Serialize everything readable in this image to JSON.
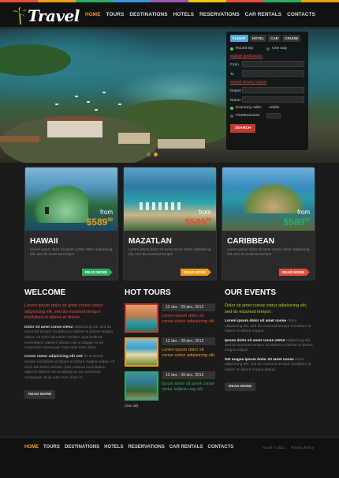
{
  "brand": {
    "name": "Travel",
    "colors": [
      "#e74c3c",
      "#f39c12",
      "#27ae60",
      "#3498db",
      "#9b59b6",
      "#f1c40f"
    ]
  },
  "nav": {
    "items": [
      {
        "label": "HOME",
        "active": true
      },
      {
        "label": "TOURS"
      },
      {
        "label": "DESTINATIONS"
      },
      {
        "label": "HOTELS"
      },
      {
        "label": "RESERVATIONS"
      },
      {
        "label": "CAR RENTALS"
      },
      {
        "label": "CONTACTS"
      }
    ]
  },
  "booking": {
    "tabs": [
      "FLIGHT",
      "HOTEL",
      "CAR",
      "CRUISE"
    ],
    "trip_round": "Round trip",
    "trip_one": "One way",
    "multi": "Multiple destinations",
    "from_label": "From",
    "to_label": "To",
    "search_nearby": "Search Nearby Airports",
    "depart_label": "Depart",
    "return_label": "Return",
    "class_economy": "Economy cabin",
    "adults_label": "Adults",
    "class_first": "First/Business",
    "search_button": "SEARCH"
  },
  "cards": [
    {
      "name": "HAWAII",
      "from": "from",
      "price": "$589",
      "cents": "99",
      "price_color": "#f39c12",
      "text": "Lorem ipsum dolor sit amet conse ctetur adipisicing elit, sed do eiusmod tempor",
      "button": "READ MORE",
      "button_color": "#27ae60"
    },
    {
      "name": "MAZATLAN",
      "from": "from",
      "price": "$589",
      "cents": "99",
      "price_color": "#e74c3c",
      "text": "Lorem ipsum dolor sit amet conse ctetur adipisicing elit, sed do eiusmod tempor",
      "button": "READ MORE",
      "button_color": "#f39c12"
    },
    {
      "name": "CARIBBEAN",
      "from": "from",
      "price": "$589",
      "cents": "99",
      "price_color": "#27ae60",
      "text": "Lorem ipsum dolor sit amet conse ctetur adipisicing elit, sed do eiusmod tempor",
      "button": "READ MORE",
      "button_color": "#e74c3c"
    }
  ],
  "welcome": {
    "title": "WELCOME",
    "lede": "Lorem ipsum dolor sit amet conse ctetur adipisicing elit, sed do eiusmod tempor incididunt ut labore et dolore",
    "p1_bold": "Dolor sit amet conse ctetur",
    "p1": "adipisicing elit, sed do eiusmod tempor incididunt ut labore et dolore magna aliqua. Ut enim ad minim veniam, quis nostrud exercitation ullamco laboris nisi ut aliquip ex ea commodo consequat. Duis aute irure dolor.",
    "p2_bold": "Conse ctetur adipisicing elit sed",
    "p2": "do eiusmod tempor incididunt ut labore et dolore magna aliqua. Ut enim ad minim veniam, quis nostrud exercitation ullamco laboris nisi ut aliquip ex ea commodo consequat. Duis aute irure dolor in.",
    "button": "READ MORE"
  },
  "hot_tours": {
    "title": "HOT TOURS",
    "items": [
      {
        "date": "12 dec - 28 dec, 2012",
        "text": "Lorem ipsum dolor sit conse ctetur adipisicing elit",
        "color": "#e74c3c"
      },
      {
        "date": "12 dec - 28 dec, 2012",
        "text": "Lorem ipsum dolor sit conse ctetur adipisicing elit",
        "color": "#f39c12"
      },
      {
        "date": "12 dec - 28 dec, 2012",
        "text": "Ipsum dolor sit amet conse ctetur adipisic-ing elit",
        "color": "#27ae60"
      }
    ],
    "see_all": "(See all)"
  },
  "events": {
    "title": "OUR EVENTS",
    "lede": "Dolor sit amet conse ctetur adipisicing elit, sed do eiusmod tempor.",
    "items": [
      {
        "bold": "Lorem ipsum dolor sit amet conse",
        "text": "ctetur adipisicing elit, sed do eiusmod tempor incididunt ut labore et dolore magna."
      },
      {
        "bold": "Ipsum dolor sit amet conse ctetur",
        "text": "adipisicing elit, sed do eiusmod tempor incididunt ut labore et dolore magna aliqua."
      },
      {
        "bold": "Set magna ipsum dolor sit amet conse",
        "text": "ctetur adipisicing elit, sed do eiusmod tempor incididunt ut labore et dolore magna aliqua."
      }
    ],
    "button": "READ MORE"
  },
  "footer": {
    "items": [
      {
        "label": "HOME",
        "active": true
      },
      {
        "label": "TOURS"
      },
      {
        "label": "DESTINATIONS"
      },
      {
        "label": "HOTELS"
      },
      {
        "label": "RESERVATIONS"
      },
      {
        "label": "CAR RENTALS"
      },
      {
        "label": "CONTACTS"
      }
    ],
    "copyright": "Travel © 2012",
    "privacy": "Privacy Policy"
  }
}
